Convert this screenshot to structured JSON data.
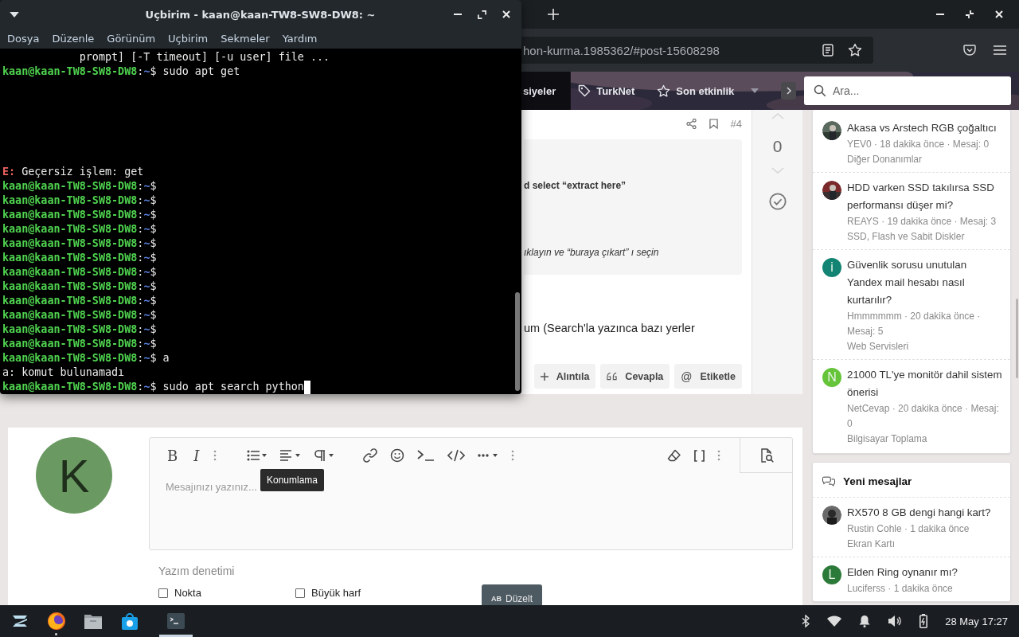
{
  "terminal": {
    "title": "Uçbirim - kaan@kaan-TW8-SW8-DW8: ~",
    "menu": [
      "Dosya",
      "Düzenle",
      "Görünüm",
      "Uçbirim",
      "Sekmeler",
      "Yardım"
    ],
    "lines": [
      {
        "kind": "output",
        "text": "            prompt] [-T timeout] [-u user] file ..."
      },
      {
        "kind": "prompt",
        "user_host": "kaan@kaan-TW8-SW8-DW8",
        "separator": ":",
        "path": "~",
        "sigil": "$",
        "command": " sudo apt get"
      },
      {
        "kind": "blank"
      },
      {
        "kind": "blank"
      },
      {
        "kind": "blank"
      },
      {
        "kind": "blank"
      },
      {
        "kind": "blank"
      },
      {
        "kind": "blank"
      },
      {
        "kind": "error",
        "prefix": "E:",
        "text": " Geçersiz işlem: get"
      },
      {
        "kind": "prompt",
        "user_host": "kaan@kaan-TW8-SW8-DW8",
        "separator": ":",
        "path": "~",
        "sigil": "$"
      },
      {
        "kind": "prompt",
        "user_host": "kaan@kaan-TW8-SW8-DW8",
        "separator": ":",
        "path": "~",
        "sigil": "$"
      },
      {
        "kind": "prompt",
        "user_host": "kaan@kaan-TW8-SW8-DW8",
        "separator": ":",
        "path": "~",
        "sigil": "$"
      },
      {
        "kind": "prompt",
        "user_host": "kaan@kaan-TW8-SW8-DW8",
        "separator": ":",
        "path": "~",
        "sigil": "$"
      },
      {
        "kind": "prompt",
        "user_host": "kaan@kaan-TW8-SW8-DW8",
        "separator": ":",
        "path": "~",
        "sigil": "$"
      },
      {
        "kind": "prompt",
        "user_host": "kaan@kaan-TW8-SW8-DW8",
        "separator": ":",
        "path": "~",
        "sigil": "$"
      },
      {
        "kind": "prompt",
        "user_host": "kaan@kaan-TW8-SW8-DW8",
        "separator": ":",
        "path": "~",
        "sigil": "$"
      },
      {
        "kind": "prompt",
        "user_host": "kaan@kaan-TW8-SW8-DW8",
        "separator": ":",
        "path": "~",
        "sigil": "$"
      },
      {
        "kind": "prompt",
        "user_host": "kaan@kaan-TW8-SW8-DW8",
        "separator": ":",
        "path": "~",
        "sigil": "$"
      },
      {
        "kind": "prompt",
        "user_host": "kaan@kaan-TW8-SW8-DW8",
        "separator": ":",
        "path": "~",
        "sigil": "$"
      },
      {
        "kind": "prompt",
        "user_host": "kaan@kaan-TW8-SW8-DW8",
        "separator": ":",
        "path": "~",
        "sigil": "$"
      },
      {
        "kind": "prompt",
        "user_host": "kaan@kaan-TW8-SW8-DW8",
        "separator": ":",
        "path": "~",
        "sigil": "$"
      },
      {
        "kind": "prompt",
        "user_host": "kaan@kaan-TW8-SW8-DW8",
        "separator": ":",
        "path": "~",
        "sigil": "$",
        "command": " a"
      },
      {
        "kind": "output",
        "text": "a: komut bulunamadı"
      },
      {
        "kind": "prompt",
        "user_host": "kaan@kaan-TW8-SW8-DW8",
        "separator": ":",
        "path": "~",
        "sigil": "$",
        "command": " sudo apt search python",
        "cursor": true
      }
    ]
  },
  "browser": {
    "url": "hon-kurma.1985362/#post-15608298",
    "nav": [
      {
        "kind": "plain",
        "label": "siyeler",
        "dropdown": false
      },
      {
        "kind": "tag",
        "label": "TurkNet",
        "dropdown": false
      },
      {
        "kind": "star",
        "label": "Son etkinlik",
        "dropdown": true
      }
    ],
    "search": {
      "placeholder": "Ara..."
    }
  },
  "post": {
    "number": "#4",
    "quote": [
      {
        "kind": "bold",
        "text": "d select “extract here”"
      },
      {
        "kind": "italic",
        "text": "ıklayın ve “buraya çıkart” ı seçin"
      }
    ],
    "body": "um (Search'la yazınca bazı yerler",
    "actions": [
      {
        "kind": "plus",
        "label": "Alıntıla"
      },
      {
        "kind": "quote",
        "label": "Cevapla"
      },
      {
        "kind": "symbol",
        "symbol": "@",
        "label": "Etiketle"
      }
    ],
    "votes": "0"
  },
  "reply": {
    "avatar_letter": "K",
    "editor": {
      "bold": "B",
      "italic": "I",
      "placeholder": "Mesajınızı yazınız...",
      "tooltip": "Konumlama"
    },
    "spellcheck": {
      "title": "Yazım denetimi",
      "options": [
        {
          "label": "Nokta",
          "checked": false
        },
        {
          "label": "Büyük harf",
          "checked": false
        }
      ],
      "button": {
        "badge": "AB",
        "label": "Düzelt"
      }
    }
  },
  "sidebar": {
    "threads": [
      {
        "title": "Akasa vs Arstech RGB çoğaltıcı",
        "meta": "YEV0 · 18 dakika önce · Mesaj: 0",
        "category": "Diğer Donanımlar"
      },
      {
        "title": "HDD varken SSD takılırsa SSD performansı düşer mi?",
        "meta": "REAYS · 19 dakika önce · Mesaj: 3",
        "category": "SSD, Flash ve Sabit Diskler"
      },
      {
        "avatar": {
          "kind": "letter",
          "letter": "i",
          "color": "#138473"
        },
        "title": "Güvenlik sorusu unutulan Yandex mail hesabı nasıl kurtarılır?",
        "meta": "Hmmmmmm · 20 dakika önce · Mesaj: 5",
        "category": "Web Servisleri"
      },
      {
        "avatar": {
          "kind": "letter",
          "letter": "N",
          "color": "#66c43a"
        },
        "title": "21000 TL'ye monitör dahil sistem önerisi",
        "meta": "NetCevap · 20 dakika önce · Mesaj: 0",
        "category": "Bilgisayar Toplama"
      }
    ],
    "new_messages": {
      "title": "Yeni mesajlar",
      "items": [
        {
          "title": "RX570 8 GB dengi hangi kart?",
          "meta": "Rustin Cohle · 1 dakika önce",
          "category": "Ekran Kartı"
        },
        {
          "avatar": {
            "kind": "letter",
            "letter": "L",
            "color": "#2c7a3a"
          },
          "title": "Elden Ring oynanır mı?",
          "meta": "Luciferss · 1 dakika önce"
        }
      ]
    }
  },
  "taskbar": {
    "apps": [
      {
        "kind": "launcher",
        "selected": false,
        "running": false
      },
      {
        "kind": "browser",
        "selected": false,
        "running": true
      },
      {
        "kind": "files",
        "selected": false,
        "running": false
      },
      {
        "kind": "store",
        "selected": false,
        "running": false
      },
      {
        "kind": "terminal",
        "selected": true,
        "running": true
      }
    ],
    "clock": "28 May 17:27"
  }
}
